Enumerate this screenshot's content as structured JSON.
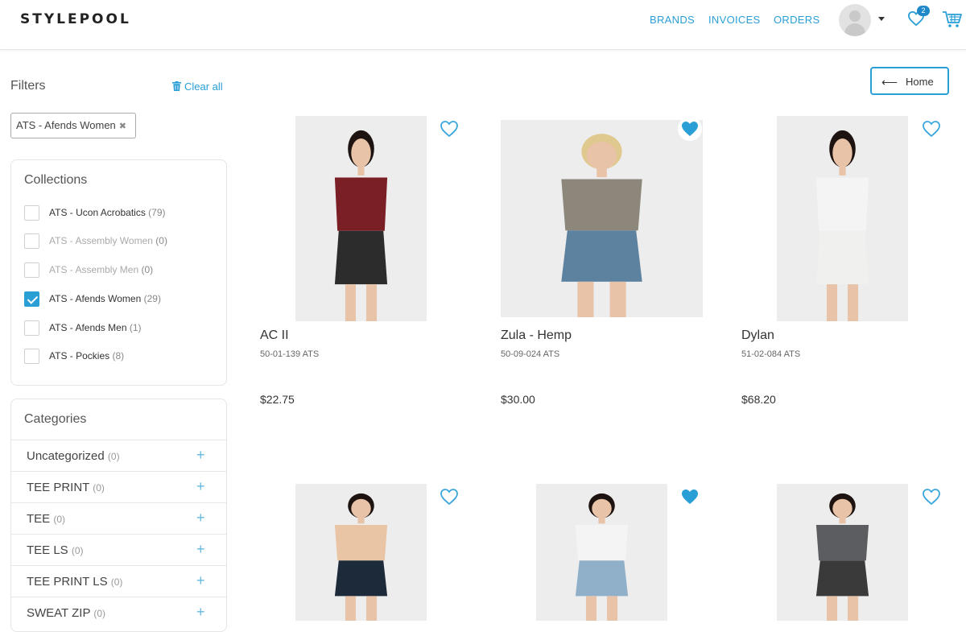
{
  "header": {
    "logo": "STYLEPOOL",
    "nav": [
      "BRANDS",
      "INVOICES",
      "ORDERS"
    ],
    "wishlist_count": "2",
    "accent_color": "#2a9fd6"
  },
  "sidebar": {
    "filters_title": "Filters",
    "clear_all": "Clear all",
    "active_filter": "ATS - Afends Women",
    "collections_title": "Collections",
    "collections": [
      {
        "label": "ATS - Ucon Acrobatics",
        "count": "(79)",
        "checked": false,
        "disabled": false
      },
      {
        "label": "ATS - Assembly Women",
        "count": "(0)",
        "checked": false,
        "disabled": true
      },
      {
        "label": "ATS - Assembly Men",
        "count": "(0)",
        "checked": false,
        "disabled": true
      },
      {
        "label": "ATS - Afends Women",
        "count": "(29)",
        "checked": true,
        "disabled": false
      },
      {
        "label": "ATS - Afends Men",
        "count": "(1)",
        "checked": false,
        "disabled": false
      },
      {
        "label": "ATS - Pockies",
        "count": "(8)",
        "checked": false,
        "disabled": false
      }
    ],
    "categories_title": "Categories",
    "categories": [
      {
        "label": "Uncategorized",
        "count": "(0)"
      },
      {
        "label": "TEE PRINT",
        "count": "(0)"
      },
      {
        "label": "TEE",
        "count": "(0)"
      },
      {
        "label": "TEE LS",
        "count": "(0)"
      },
      {
        "label": "TEE PRINT LS",
        "count": "(0)"
      },
      {
        "label": "SWEAT ZIP",
        "count": "(0)"
      }
    ]
  },
  "home_button": "Home",
  "products": [
    {
      "name": "AC II",
      "sku": "50-01-139 ATS",
      "price": "$22.75",
      "favorited": false
    },
    {
      "name": "Zula - Hemp",
      "sku": "50-09-024 ATS",
      "price": "$30.00",
      "favorited": true
    },
    {
      "name": "Dylan",
      "sku": "51-02-084 ATS",
      "price": "$68.20",
      "favorited": false
    },
    {
      "name": "",
      "sku": "",
      "price": "",
      "favorited": false
    },
    {
      "name": "",
      "sku": "",
      "price": "",
      "favorited": true
    },
    {
      "name": "",
      "sku": "",
      "price": "",
      "favorited": false
    }
  ]
}
